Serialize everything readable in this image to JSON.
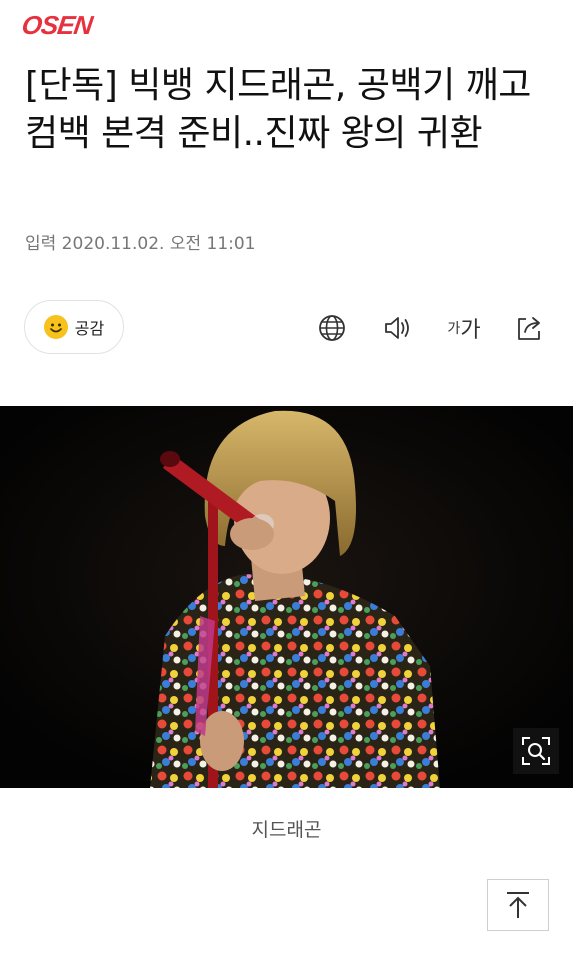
{
  "brand": {
    "logo_text": "OSEN"
  },
  "article": {
    "headline": "[단독] 빅뱅 지드래곤, 공백기 깨고 컴백 본격 준비..진짜 왕의 귀환",
    "meta": "입력 2020.11.02. 오전 11:01",
    "photo_caption": "지드래곤"
  },
  "toolbar": {
    "react_label": "공감",
    "font_small": "가",
    "font_large": "가",
    "icons": [
      "globe-icon",
      "speaker-icon",
      "font-size-icon",
      "share-icon"
    ]
  },
  "colors": {
    "brand_red": "#e8313f",
    "emoji_yellow": "#f7c21b"
  }
}
